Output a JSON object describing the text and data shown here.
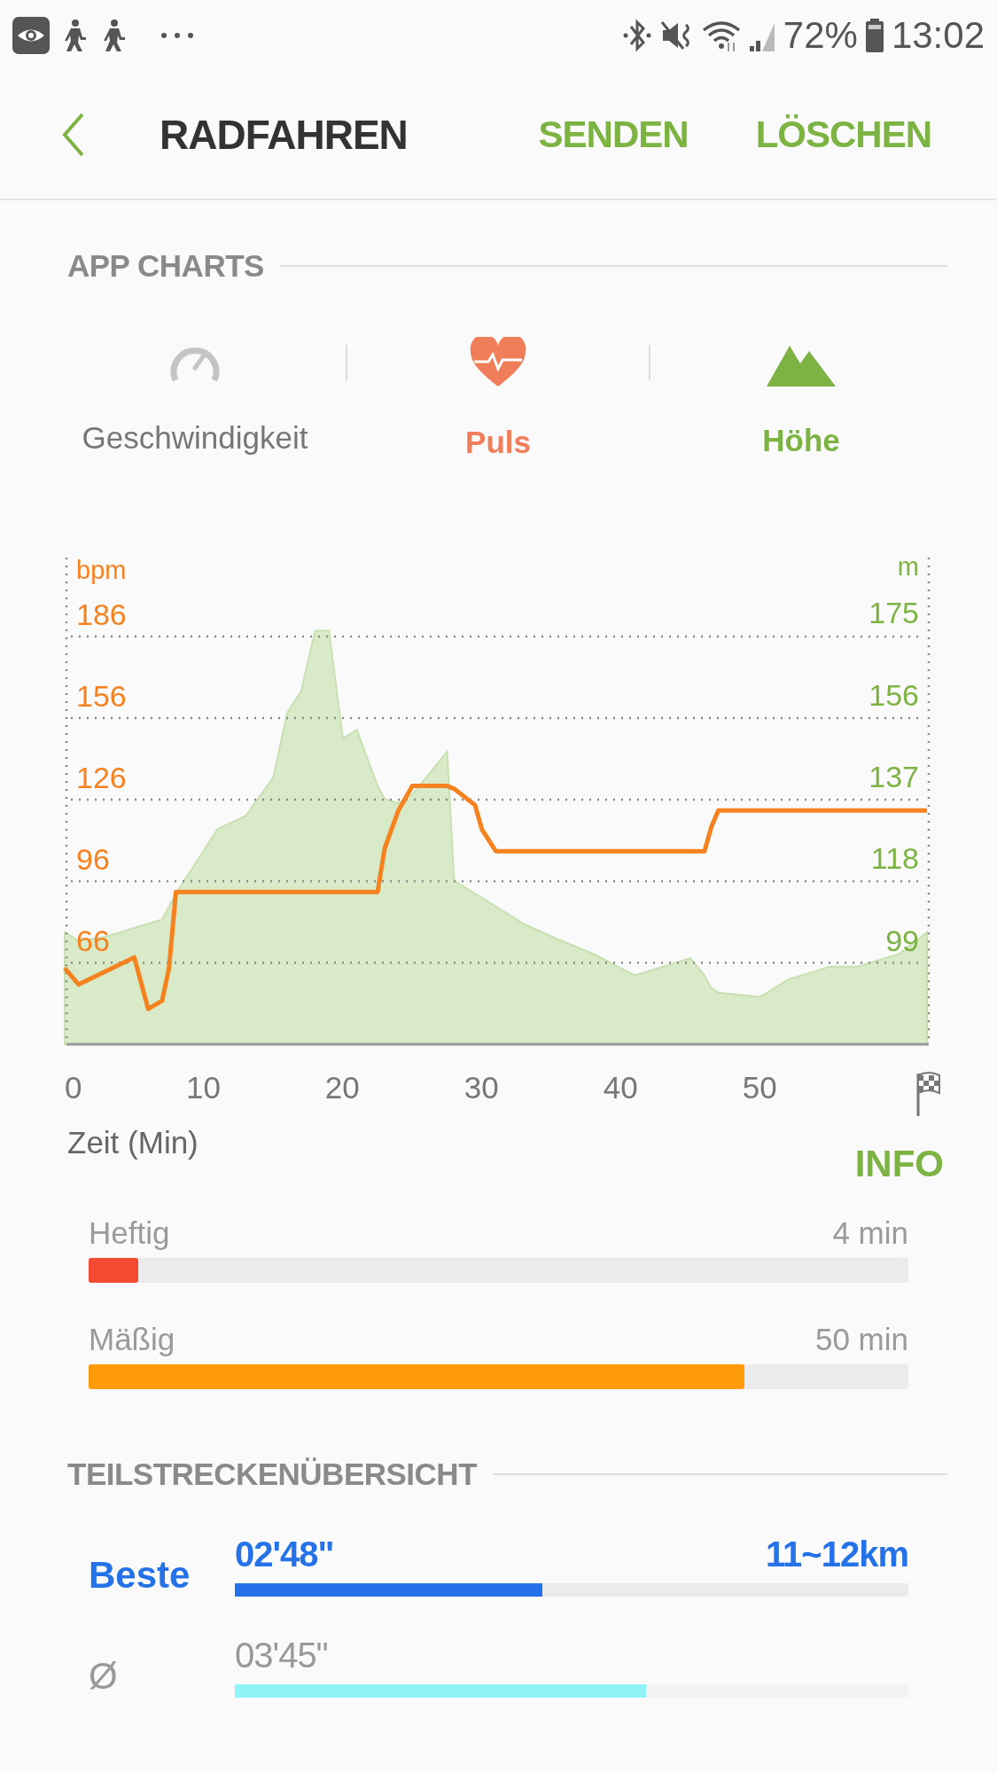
{
  "status_bar": {
    "battery": "72%",
    "time": "13:02"
  },
  "app_bar": {
    "title": "RADFAHREN",
    "actions": [
      "SENDEN",
      "LÖSCHEN"
    ]
  },
  "app_charts": {
    "heading": "APP CHARTS",
    "tabs": [
      {
        "label": "Geschwindigkeit",
        "kind": "speed",
        "selected": false
      },
      {
        "label": "Puls",
        "kind": "heart",
        "selected": true,
        "color": "#f07e5a"
      },
      {
        "label": "Höhe",
        "kind": "mountain",
        "selected": true,
        "color": "#7cb342"
      }
    ],
    "chart_data": {
      "type": "line",
      "grid": true,
      "ylabel": "bpm",
      "y2label": "m",
      "xlabel": "Zeit (Min)",
      "xlim": [
        0,
        62
      ],
      "ylim": [
        36,
        215
      ],
      "y2lim": [
        80,
        193
      ],
      "xticks": [
        0,
        10,
        20,
        30,
        40,
        50
      ],
      "yticks": [
        186,
        156,
        126,
        96,
        66
      ],
      "y2ticks": [
        175,
        156,
        137,
        118,
        99
      ],
      "x": [
        0,
        1,
        3,
        5,
        6,
        7,
        7.5,
        8,
        9,
        11,
        13,
        15,
        16,
        17,
        18,
        19,
        20,
        21,
        22.5,
        23,
        24,
        25,
        26,
        27.5,
        28,
        29.5,
        30,
        31,
        33,
        35,
        38,
        41,
        45,
        46,
        46.5,
        47,
        50,
        52,
        55,
        57,
        60,
        62
      ],
      "series": [
        {
          "type": "line",
          "color": "#f5821f",
          "values": [
            64,
            58,
            63,
            68,
            49,
            52,
            64,
            92,
            92,
            92,
            92,
            92,
            92,
            92,
            92,
            92,
            92,
            92,
            92,
            108,
            122,
            131,
            131,
            131,
            130,
            124,
            115,
            107,
            107,
            107,
            107,
            107,
            107,
            107,
            116,
            122,
            122,
            122,
            122,
            122,
            122,
            122
          ]
        },
        {
          "type": "area",
          "axis": "y2",
          "color": "#d8eac8",
          "values": [
            106,
            104,
            105,
            107,
            108,
            109,
            112,
            115,
            120,
            130,
            133,
            142,
            157,
            162,
            176,
            176,
            151,
            153,
            140,
            137,
            136,
            138,
            142,
            148,
            118,
            115,
            114,
            112,
            108,
            105,
            101,
            96,
            100,
            96,
            93,
            92,
            91,
            95,
            98,
            98,
            101,
            106
          ]
        }
      ]
    },
    "info": "INFO",
    "zones": [
      {
        "label": "Heftig",
        "value": "4 min",
        "level": 0.06,
        "color": "#f44a31"
      },
      {
        "label": "Mäßig",
        "value": "50 min",
        "level": 0.8,
        "color": "#ff9a0a"
      }
    ]
  },
  "splits": {
    "heading": "TEILSTRECKENÜBERSICHT",
    "rows": [
      {
        "kind": "best",
        "label": "Beste",
        "time": "02'48\"",
        "segment": "11~12km",
        "level": 0.456,
        "color": "#2571e8"
      },
      {
        "kind": "average",
        "label": "Ø",
        "time": "03'45\"",
        "level": 0.61,
        "color": "#8ff3f8"
      }
    ]
  }
}
